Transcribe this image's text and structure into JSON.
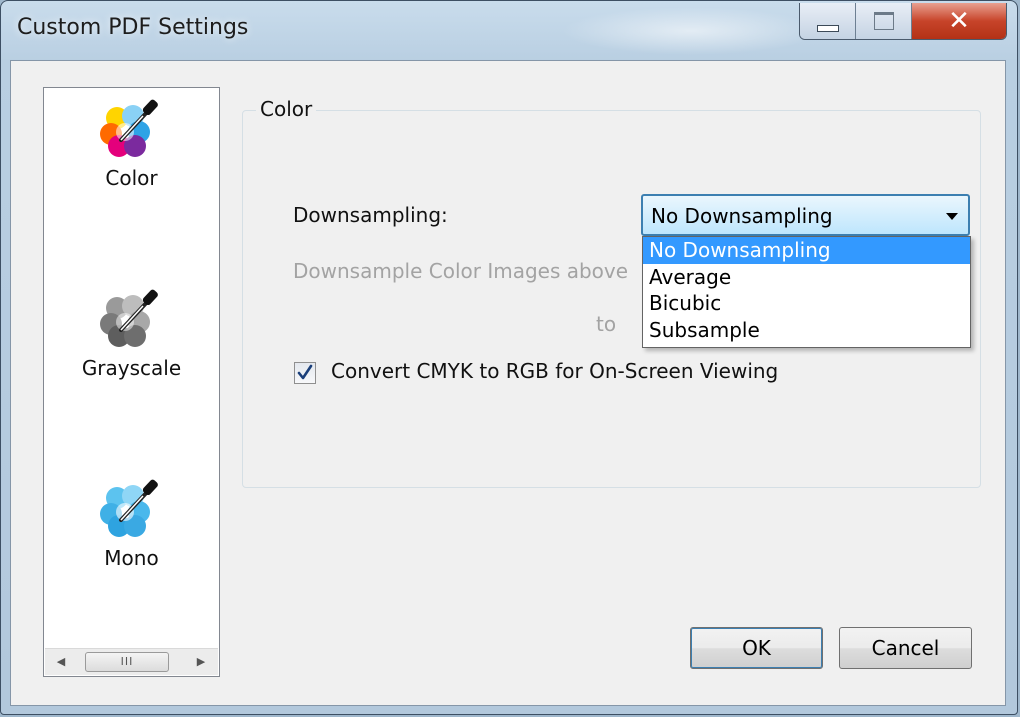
{
  "window": {
    "title": "Custom PDF Settings"
  },
  "titlebar": {
    "buttons": [
      "minimize-icon",
      "maximize-icon",
      "close-icon"
    ],
    "close_glyph": "✕"
  },
  "sidebar": {
    "items": [
      {
        "label": "Color",
        "icon": "color-eyedropper-icon"
      },
      {
        "label": "Grayscale",
        "icon": "grayscale-eyedropper-icon"
      },
      {
        "label": "Mono",
        "icon": "mono-eyedropper-icon"
      }
    ],
    "scrollbar": {
      "left_arrow": "◀",
      "right_arrow": "▶",
      "thumb_grip": "III"
    }
  },
  "group": {
    "title": "Color",
    "downsampling_label": "Downsampling:",
    "downsample_above_label": "Downsample Color Images above",
    "to_label": "to",
    "downsampling_select": {
      "value": "No Downsampling",
      "options": [
        "No Downsampling",
        "Average",
        "Bicubic",
        "Subsample"
      ],
      "highlighted": "No Downsampling"
    },
    "convert_checkbox": {
      "label": "Convert CMYK to RGB for On-Screen Viewing",
      "checked": true
    }
  },
  "buttons": {
    "ok": "OK",
    "cancel": "Cancel"
  },
  "colors": {
    "selection": "#3399ff",
    "focus_border": "#3c7fb1",
    "close_button": "#c7442a"
  }
}
